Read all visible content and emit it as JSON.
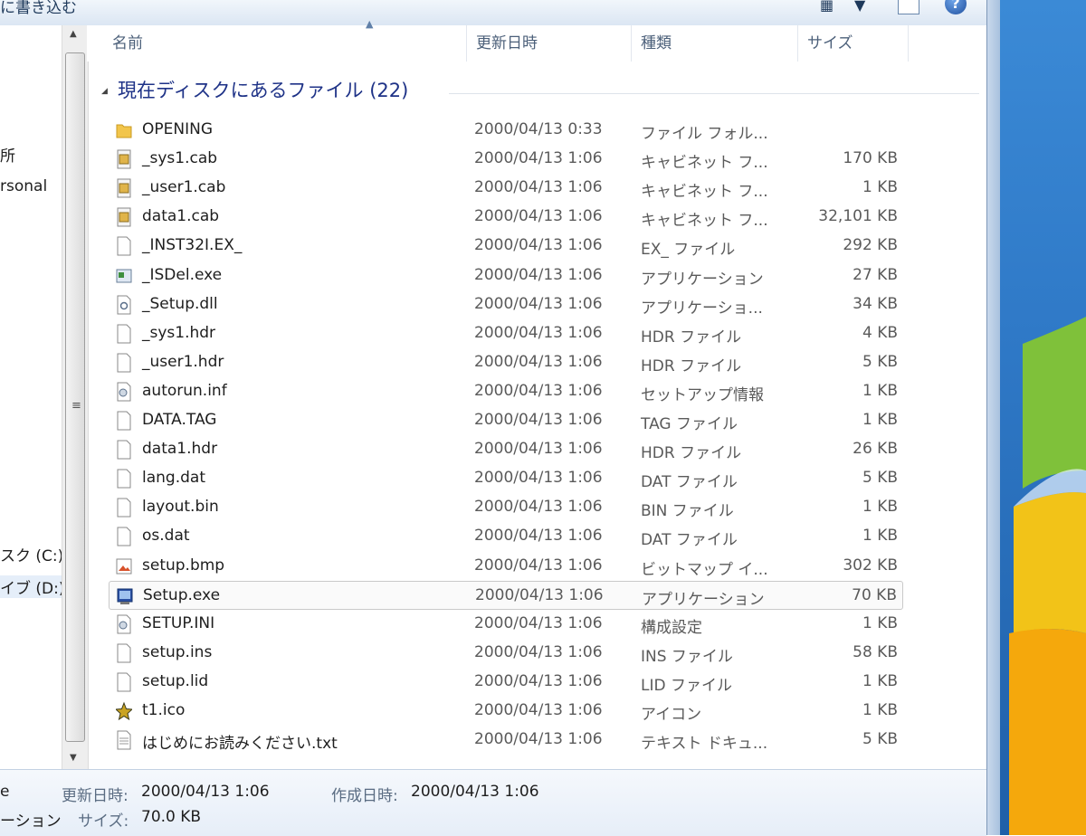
{
  "toolbar": {
    "title_fragment": "に書き込む"
  },
  "nav": {
    "items": [
      "所",
      "rsonal",
      "スク (C:)",
      "イブ (D:)"
    ]
  },
  "columns": {
    "name": "名前",
    "date": "更新日時",
    "type": "種類",
    "size": "サイズ"
  },
  "group": {
    "title": "現在ディスクにあるファイル (22)"
  },
  "files": [
    {
      "name": "OPENING",
      "date": "2000/04/13 0:33",
      "type": "ファイル フォル...",
      "size": "",
      "icon": "folder-icon"
    },
    {
      "name": "_sys1.cab",
      "date": "2000/04/13 1:06",
      "type": "キャビネット フ...",
      "size": "170 KB",
      "icon": "cabinet-icon"
    },
    {
      "name": "_user1.cab",
      "date": "2000/04/13 1:06",
      "type": "キャビネット フ...",
      "size": "1 KB",
      "icon": "cabinet-icon"
    },
    {
      "name": "data1.cab",
      "date": "2000/04/13 1:06",
      "type": "キャビネット フ...",
      "size": "32,101 KB",
      "icon": "cabinet-icon"
    },
    {
      "name": "_INST32I.EX_",
      "date": "2000/04/13 1:06",
      "type": "EX_ ファイル",
      "size": "292 KB",
      "icon": "file-icon"
    },
    {
      "name": "_ISDel.exe",
      "date": "2000/04/13 1:06",
      "type": "アプリケーション",
      "size": "27 KB",
      "icon": "application-icon"
    },
    {
      "name": "_Setup.dll",
      "date": "2000/04/13 1:06",
      "type": "アプリケーショ...",
      "size": "34 KB",
      "icon": "dll-icon"
    },
    {
      "name": "_sys1.hdr",
      "date": "2000/04/13 1:06",
      "type": "HDR ファイル",
      "size": "4 KB",
      "icon": "file-icon"
    },
    {
      "name": "_user1.hdr",
      "date": "2000/04/13 1:06",
      "type": "HDR ファイル",
      "size": "5 KB",
      "icon": "file-icon"
    },
    {
      "name": "autorun.inf",
      "date": "2000/04/13 1:06",
      "type": "セットアップ情報",
      "size": "1 KB",
      "icon": "settings-file-icon"
    },
    {
      "name": "DATA.TAG",
      "date": "2000/04/13 1:06",
      "type": "TAG ファイル",
      "size": "1 KB",
      "icon": "file-icon"
    },
    {
      "name": "data1.hdr",
      "date": "2000/04/13 1:06",
      "type": "HDR ファイル",
      "size": "26 KB",
      "icon": "file-icon"
    },
    {
      "name": "lang.dat",
      "date": "2000/04/13 1:06",
      "type": "DAT ファイル",
      "size": "5 KB",
      "icon": "file-icon"
    },
    {
      "name": "layout.bin",
      "date": "2000/04/13 1:06",
      "type": "BIN ファイル",
      "size": "1 KB",
      "icon": "file-icon"
    },
    {
      "name": "os.dat",
      "date": "2000/04/13 1:06",
      "type": "DAT ファイル",
      "size": "1 KB",
      "icon": "file-icon"
    },
    {
      "name": "setup.bmp",
      "date": "2000/04/13 1:06",
      "type": "ビットマップ イ...",
      "size": "302 KB",
      "icon": "bitmap-icon"
    },
    {
      "name": "Setup.exe",
      "date": "2000/04/13 1:06",
      "type": "アプリケーション",
      "size": "70 KB",
      "icon": "setup-exe-icon",
      "selected": true
    },
    {
      "name": "SETUP.INI",
      "date": "2000/04/13 1:06",
      "type": "構成設定",
      "size": "1 KB",
      "icon": "settings-file-icon"
    },
    {
      "name": "setup.ins",
      "date": "2000/04/13 1:06",
      "type": "INS ファイル",
      "size": "58 KB",
      "icon": "file-icon"
    },
    {
      "name": "setup.lid",
      "date": "2000/04/13 1:06",
      "type": "LID ファイル",
      "size": "1 KB",
      "icon": "file-icon"
    },
    {
      "name": "t1.ico",
      "date": "2000/04/13 1:06",
      "type": "アイコン",
      "size": "1 KB",
      "icon": "star-icon"
    },
    {
      "name": "はじめにお読みください.txt",
      "date": "2000/04/13 1:06",
      "type": "テキスト ドキュ...",
      "size": "5 KB",
      "icon": "text-file-icon"
    }
  ],
  "details": {
    "name_fragment": "e",
    "type_fragment": "ーション",
    "modified_label": "更新日時:",
    "modified_value": "2000/04/13 1:06",
    "created_label": "作成日時:",
    "created_value": "2000/04/13 1:06",
    "size_label": "サイズ:",
    "size_value": "70.0 KB"
  },
  "colors": {
    "group_title": "#1e3287",
    "header_text": "#4c607a",
    "selection_border": "#c9c9c9"
  }
}
